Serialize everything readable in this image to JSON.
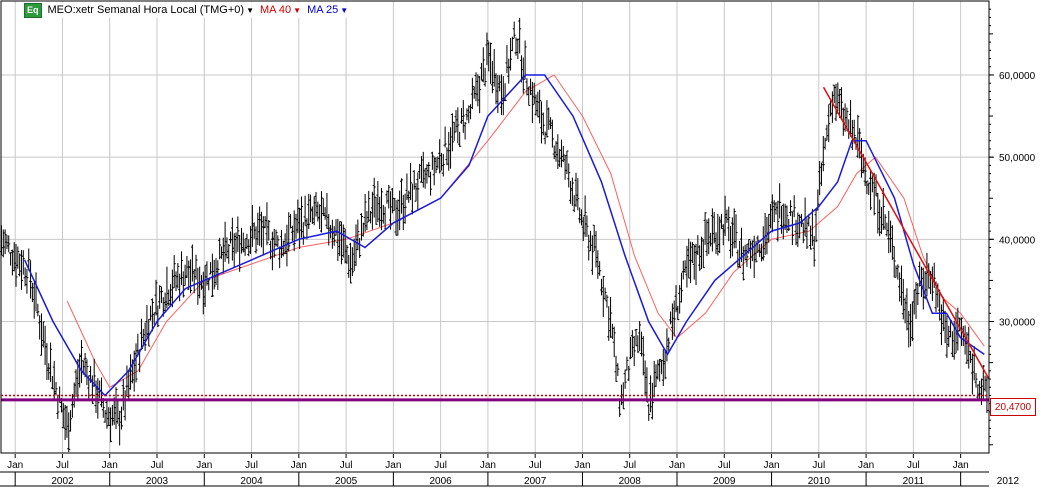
{
  "legend": {
    "symbol_icon": "Eq",
    "symbol_label": "MEO:xetr Semanal Hora Local (TMG+0)",
    "ma40_label": "MA 40",
    "ma25_label": "MA 25",
    "symbol_color": "#000000",
    "ma40_color": "#d40000",
    "ma25_color": "#0000cc"
  },
  "colors": {
    "price_bars": "#000000",
    "ma40": "#ff6060",
    "ma25": "#1a1adb",
    "trendline": "#e01010",
    "support_line": "#800080",
    "last_price_line": "#cc0000",
    "grid": "#c8c8c8"
  },
  "chart_data": {
    "type": "line",
    "title": "",
    "y_axis_position": "right",
    "grid": true,
    "ylim": [
      14,
      69
    ],
    "y_ticks": [
      {
        "value": 30,
        "label": "30,0000"
      },
      {
        "value": 40,
        "label": "40,0000"
      },
      {
        "value": 50,
        "label": "50,0000"
      },
      {
        "value": 60,
        "label": "60,0000"
      }
    ],
    "x_range": [
      2001.85,
      2012.3
    ],
    "x_month_ticks": [
      {
        "x": 2002.0,
        "label": "Jan"
      },
      {
        "x": 2002.5,
        "label": "Jul"
      },
      {
        "x": 2003.0,
        "label": "Jan"
      },
      {
        "x": 2003.5,
        "label": "Jul"
      },
      {
        "x": 2004.0,
        "label": "Jan"
      },
      {
        "x": 2004.5,
        "label": "Jul"
      },
      {
        "x": 2005.0,
        "label": "Jan"
      },
      {
        "x": 2005.5,
        "label": "Jul"
      },
      {
        "x": 2006.0,
        "label": "Jan"
      },
      {
        "x": 2006.5,
        "label": "Jul"
      },
      {
        "x": 2007.0,
        "label": "Jan"
      },
      {
        "x": 2007.5,
        "label": "Jul"
      },
      {
        "x": 2008.0,
        "label": "Jan"
      },
      {
        "x": 2008.5,
        "label": "Jul"
      },
      {
        "x": 2009.0,
        "label": "Jan"
      },
      {
        "x": 2009.5,
        "label": "Jul"
      },
      {
        "x": 2010.0,
        "label": "Jan"
      },
      {
        "x": 2010.5,
        "label": "Jul"
      },
      {
        "x": 2011.0,
        "label": "Jan"
      },
      {
        "x": 2011.5,
        "label": "Jul"
      },
      {
        "x": 2012.0,
        "label": "Jan"
      }
    ],
    "x_year_labels": [
      {
        "x": 2002.0,
        "label": "2002"
      },
      {
        "x": 2003.0,
        "label": "2003"
      },
      {
        "x": 2004.0,
        "label": "2004"
      },
      {
        "x": 2005.0,
        "label": "2005"
      },
      {
        "x": 2006.0,
        "label": "2006"
      },
      {
        "x": 2007.0,
        "label": "2007"
      },
      {
        "x": 2008.0,
        "label": "2008"
      },
      {
        "x": 2009.0,
        "label": "2009"
      },
      {
        "x": 2010.0,
        "label": "2010"
      },
      {
        "x": 2011.0,
        "label": "2011"
      },
      {
        "x": 2012.0,
        "label": "2012"
      }
    ],
    "series": [
      {
        "name": "MEO:xetr",
        "kind": "weekly-bars",
        "x": [
          2001.85,
          2002.0,
          2002.15,
          2002.3,
          2002.45,
          2002.55,
          2002.7,
          2002.85,
          2002.95,
          2003.1,
          2003.25,
          2003.4,
          2003.6,
          2003.8,
          2004.0,
          2004.2,
          2004.4,
          2004.6,
          2004.8,
          2005.0,
          2005.2,
          2005.4,
          2005.55,
          2005.7,
          2005.85,
          2006.0,
          2006.2,
          2006.4,
          2006.6,
          2006.8,
          2007.0,
          2007.15,
          2007.3,
          2007.4,
          2007.55,
          2007.7,
          2007.85,
          2008.0,
          2008.15,
          2008.3,
          2008.4,
          2008.5,
          2008.6,
          2008.7,
          2008.85,
          2008.95,
          2009.1,
          2009.3,
          2009.5,
          2009.7,
          2009.9,
          2010.1,
          2010.3,
          2010.45,
          2010.55,
          2010.65,
          2010.75,
          2010.9,
          2011.0,
          2011.15,
          2011.3,
          2011.45,
          2011.55,
          2011.7,
          2011.85,
          2012.0,
          2012.15,
          2012.25
        ],
        "values": [
          40,
          38,
          36,
          28,
          21,
          17,
          25,
          22,
          19,
          18,
          24,
          30,
          34,
          36,
          35,
          38,
          40,
          41,
          39,
          42,
          43,
          41,
          37,
          42,
          45,
          43,
          46,
          48,
          52,
          55,
          62,
          58,
          65,
          60,
          55,
          52,
          48,
          42,
          38,
          30,
          20,
          25,
          28,
          20,
          25,
          30,
          36,
          40,
          42,
          38,
          40,
          44,
          42,
          40,
          50,
          58,
          55,
          52,
          48,
          44,
          38,
          30,
          34,
          36,
          28,
          29,
          24,
          21
        ],
        "low": [
          18.5,
          16.8,
          17.5,
          19.2
        ],
        "high_peak": 68.0
      },
      {
        "name": "MA 40",
        "x": [
          2002.55,
          2002.85,
          2003.0,
          2003.3,
          2003.6,
          2004.0,
          2004.5,
          2005.0,
          2005.5,
          2006.0,
          2006.5,
          2007.0,
          2007.4,
          2007.7,
          2008.0,
          2008.3,
          2008.55,
          2008.8,
          2009.0,
          2009.3,
          2009.6,
          2010.0,
          2010.4,
          2010.7,
          2010.9,
          2011.1,
          2011.4,
          2011.6,
          2011.8,
          2012.0,
          2012.25
        ],
        "values": [
          32.5,
          25,
          22,
          24,
          30,
          35,
          37,
          39,
          40,
          42,
          45,
          52,
          58,
          60,
          55,
          48,
          38,
          31,
          28,
          31,
          36,
          40,
          41,
          44,
          48,
          50,
          45,
          38,
          33,
          31,
          27
        ]
      },
      {
        "name": "MA 25",
        "x": [
          2002.1,
          2002.4,
          2002.7,
          2002.95,
          2003.2,
          2003.5,
          2003.8,
          2004.2,
          2004.6,
          2005.0,
          2005.4,
          2005.7,
          2006.0,
          2006.5,
          2006.8,
          2007.0,
          2007.4,
          2007.6,
          2007.9,
          2008.2,
          2008.45,
          2008.7,
          2008.9,
          2009.1,
          2009.4,
          2009.7,
          2010.0,
          2010.3,
          2010.5,
          2010.7,
          2010.85,
          2011.0,
          2011.3,
          2011.5,
          2011.7,
          2011.85,
          2012.0,
          2012.25
        ],
        "values": [
          37.5,
          30,
          24,
          21,
          24,
          30,
          34,
          36,
          38,
          40,
          41,
          39,
          42,
          45,
          49,
          55,
          60,
          60,
          55,
          47,
          38,
          30,
          26,
          30,
          35,
          38,
          41,
          42,
          44,
          47,
          52,
          52,
          45,
          37,
          31,
          31,
          28,
          26
        ]
      }
    ],
    "annotations": [
      {
        "kind": "trendline",
        "from": [
          2010.55,
          58.5
        ],
        "to": [
          2012.3,
          23.0
        ]
      },
      {
        "kind": "horizontal-line",
        "y": 20.47,
        "label": "20,4700"
      },
      {
        "kind": "horizontal-line",
        "y": 21.0,
        "style": "dotted"
      }
    ]
  }
}
